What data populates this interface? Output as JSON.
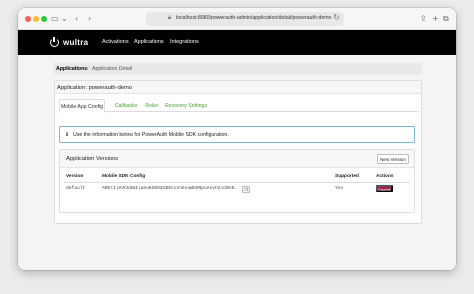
{
  "browser": {
    "url": "localhost:8080/powerauth-admin/application/detail/powerauth-demo",
    "icons": [
      "sidebar-icon",
      "chevron-down-icon",
      "back-icon",
      "forward-icon",
      "lock-icon",
      "reload-icon",
      "share-icon",
      "new-tab-icon",
      "tabs-overview-icon"
    ]
  },
  "navbar": {
    "brand": "wultra",
    "links": [
      "Activations",
      "Applications",
      "Integrations"
    ]
  },
  "breadcrumb": {
    "items": [
      "Applications",
      "Application Detail"
    ],
    "separator": "/"
  },
  "card": {
    "title": "Application: powerauth-demo",
    "tabs": [
      "Mobile App Config",
      "Callbacks",
      "Roles",
      "Recovery Settings"
    ],
    "active_tab": "Mobile App Config"
  },
  "alert": {
    "icon": "info-icon",
    "text": "Use the information below for PowerAuth Mobile SDK configuration."
  },
  "versions": {
    "title": "Application Versions",
    "new_button": "New Version",
    "columns": [
      "Version",
      "Mobile SDK Config",
      "Supported",
      "Actions"
    ],
    "rows": [
      {
        "version": "default",
        "sdk_config": "ARDlIleVCbbWIlaeuKGDOZCB9ccVnEvuWG9NpuAsvh2lCBAD...",
        "supported": "Yes",
        "action": "Disable"
      }
    ]
  },
  "colors": {
    "navbar": "#000000",
    "tab_link": "#48a02f",
    "alert_border": "#7ab8d8",
    "disable_button": "#b5145a"
  }
}
